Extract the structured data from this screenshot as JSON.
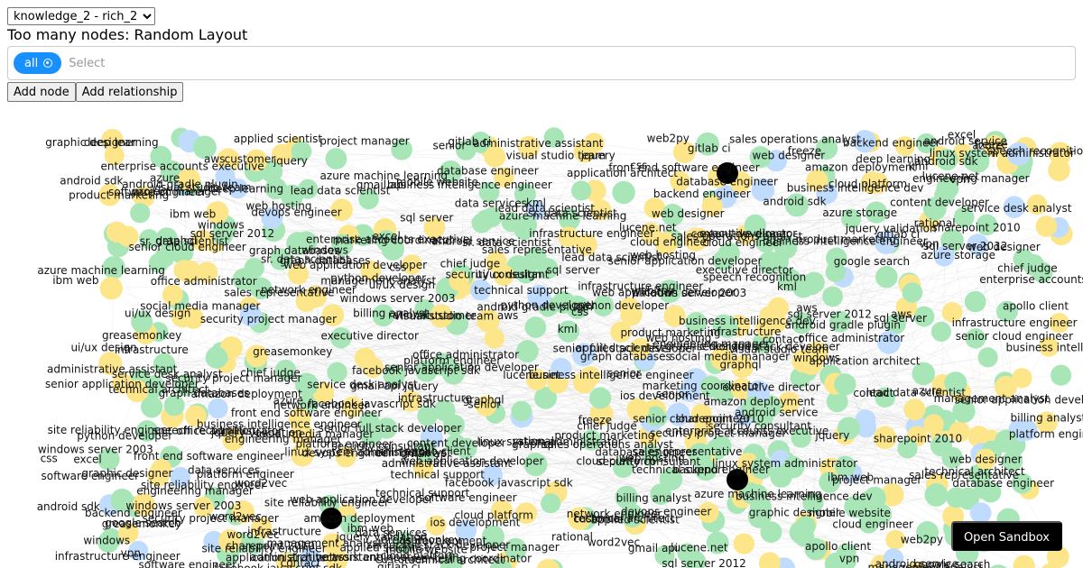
{
  "graph_selector": {
    "value": "knowledge_2 - rich_2"
  },
  "layout_message": "Too many nodes: Random Layout",
  "filter": {
    "chip_label": "all",
    "placeholder": "Select"
  },
  "buttons": {
    "add_node": "Add node",
    "add_relationship": "Add relationship",
    "open_sandbox": "Open Sandbox"
  },
  "colors": {
    "skill": "#a8e6b8",
    "role": "#fde68a",
    "other": "#bfdbfe",
    "highlight": "#000000",
    "edge": "#d9d9d9"
  },
  "node_labels": [
    "sales representative",
    "python developer",
    "greasemonkey",
    "sharepoint 2010",
    "visual studio team",
    "gitlab ci",
    "senior",
    "graph databases",
    "windows server 2003",
    "graphic designer",
    "security consultant",
    "engineering manager",
    "azure",
    "platform engineer",
    "amazon deployment",
    "infrastructure",
    "web application developer",
    "chief judge",
    "office administrator",
    "social media manager",
    "azure machine learning",
    "backend engineer",
    "sr. data scientist",
    "senior application developer",
    "business intelligence engineer",
    "enterprise accounts executive",
    "technical support",
    "project manager",
    "web designer",
    "management analyst",
    "css",
    "sql server 2012",
    "software engineer",
    "infrastructure engineer",
    "ui/ux design",
    "lucene.net",
    "administrative assistant",
    "senior full stack developer",
    "jquery",
    "senior cloud engineer",
    "database engineer",
    "security project manager",
    "android sdk",
    "kml",
    "customer",
    "executive director",
    "business intelligence dev",
    "billing analyst",
    "vpn",
    "gmail api",
    "linux system administrator",
    "facebook javascript sdk",
    "graphql",
    "android service",
    "web hosting",
    "sql server",
    "product marketing",
    "data services",
    "aws",
    "lead data scientist",
    "technical architect",
    "deep learning",
    "rational",
    "cloud platform",
    "word2vec",
    "network engineer",
    "applied scientist",
    "ibm web",
    "site reliability engineer",
    "windows",
    "devops engineer",
    "service desk analyst",
    "mobile website",
    "android gradle plugin",
    "excel",
    "contact",
    "cloud engineer",
    "marketing coordinator",
    "jquery validation",
    "apollo client",
    "sales operations analyst",
    "application architect",
    "ios development",
    "google search",
    "front end software engineer",
    "freeze",
    "web2py",
    "azure storage",
    "speech recognition",
    "content developer"
  ]
}
